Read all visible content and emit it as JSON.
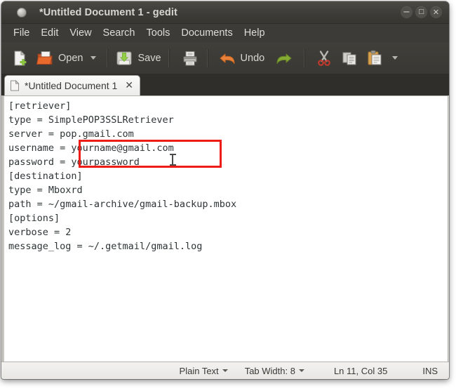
{
  "window": {
    "title": "*Untitled Document 1 - gedit",
    "app_icon": "gedit-icon",
    "controls": {
      "minimize": "−",
      "maximize": "□",
      "close": "✕"
    }
  },
  "menubar": {
    "items": [
      {
        "label": "File"
      },
      {
        "label": "Edit"
      },
      {
        "label": "View"
      },
      {
        "label": "Search"
      },
      {
        "label": "Tools"
      },
      {
        "label": "Documents"
      },
      {
        "label": "Help"
      }
    ]
  },
  "toolbar": {
    "new_label": "",
    "open_label": "Open",
    "save_label": "Save",
    "print_label": "",
    "undo_label": "Undo",
    "redo_label": "",
    "cut_label": "",
    "copy_label": "",
    "paste_label": ""
  },
  "tabs": [
    {
      "title": "*Untitled Document 1",
      "close": "✕",
      "active": true
    }
  ],
  "editor": {
    "content": "[retriever]\ntype = SimplePOP3SSLRetriever\nserver = pop.gmail.com\nusername = yourname@gmail.com\npassword = yourpassword\n[destination]\ntype = Mboxrd\npath = ~/gmail-archive/gmail-backup.mbox\n[options]\nverbose = 2\nmessage_log = ~/.getmail/gmail.log",
    "lines": [
      "[retriever]",
      "type = SimplePOP3SSLRetriever",
      "server = pop.gmail.com",
      "username = yourname@gmail.com",
      "password = yourpassword",
      "[destination]",
      "type = Mboxrd",
      "path = ~/gmail-archive/gmail-backup.mbox",
      "[options]",
      "verbose = 2",
      "message_log = ~/.getmail/gmail.log"
    ],
    "text_color": "#2e3436",
    "background": "#ffffff"
  },
  "annotation": {
    "color": "#ee1c17",
    "highlights": [
      "yourname@gmail.com",
      "yourpassword"
    ]
  },
  "statusbar": {
    "language": "Plain Text",
    "tab_width": "Tab Width: 8",
    "position": "Ln 11, Col 35",
    "insert_mode": "INS"
  },
  "colors": {
    "chrome": "#3c3b37",
    "accent_orange": "#dd4814",
    "editor_bg": "#ffffff",
    "statusbar_bg": "#efeeeb"
  }
}
